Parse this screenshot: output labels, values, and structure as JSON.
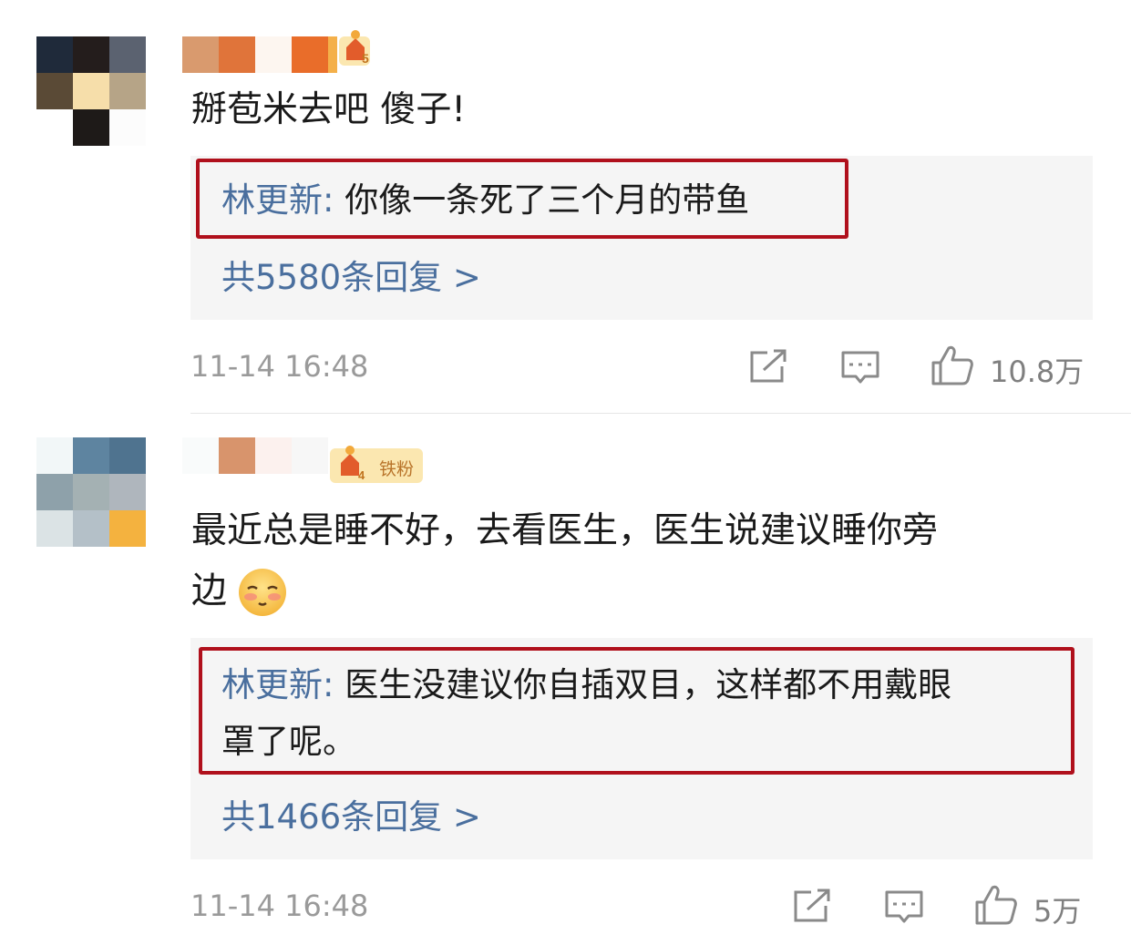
{
  "comments": [
    {
      "text": "掰苞米去吧 傻子!",
      "reply_author": "林更新",
      "reply_separator": ":",
      "reply_text_lines": [
        "你像一条死了三个月的带鱼"
      ],
      "more_replies": "共5580条回复 >",
      "time": "11-14 16:48",
      "likes": "10.8万",
      "badge_level": "5"
    },
    {
      "text_lines": [
        "最近总是睡不好，去看医生，医生说建议睡你旁",
        "边"
      ],
      "emoji": "shy-face-emoji",
      "reply_author": "林更新",
      "reply_separator": ":",
      "reply_text_lines": [
        "医生没建议你自插双目，这样都不用戴眼",
        "罩了呢。"
      ],
      "more_replies": "共1466条回复 >",
      "time": "11-14 16:48",
      "likes": "5万",
      "badge_level": "4",
      "badge_label": "铁粉"
    }
  ],
  "colors": {
    "reply_name": "#4a6f9e",
    "highlight_border": "#b0101c",
    "reply_bg": "#f5f5f5",
    "meta_gray": "#9a9a9a"
  },
  "icons": [
    "share-icon",
    "comment-icon",
    "like-icon"
  ]
}
